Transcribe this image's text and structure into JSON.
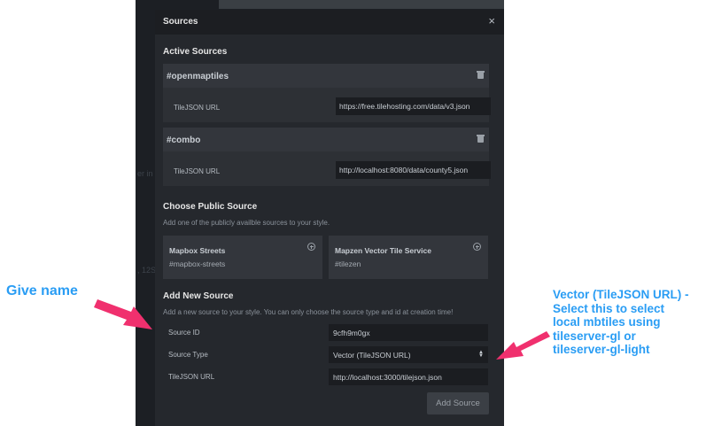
{
  "backdrop": {
    "ghost_text_1": "er in",
    "ghost_text_2": ", 12S"
  },
  "modal": {
    "title": "Sources",
    "close_icon": "×",
    "active": {
      "title": "Active Sources",
      "sources": [
        {
          "name": "#openmaptiles",
          "field_label": "TileJSON URL",
          "value": "https://free.tilehosting.com/data/v3.json"
        },
        {
          "name": "#combo",
          "field_label": "TileJSON URL",
          "value": "http://localhost:8080/data/county5.json"
        }
      ]
    },
    "public": {
      "title": "Choose Public Source",
      "description": "Add one of the publicly availble sources to your style.",
      "sources": [
        {
          "name": "Mapbox Streets",
          "id": "#mapbox-streets"
        },
        {
          "name": "Mapzen Vector Tile Service",
          "id": "#tilezen"
        }
      ]
    },
    "new_source": {
      "title": "Add New Source",
      "description": "Add a new source to your style. You can only choose the source type and id at creation time!",
      "source_id_label": "Source ID",
      "source_id_value": "9cfh9m0gx",
      "source_type_label": "Source Type",
      "source_type_value": "Vector (TileJSON URL)",
      "tilejson_label": "TileJSON URL",
      "tilejson_value": "http://localhost:3000/tilejson.json",
      "add_button": "Add Source"
    }
  },
  "annotations": {
    "left": "Give name",
    "right_lines": [
      "Vector (TileJSON URL) -",
      "Select this to select",
      "local mbtiles using",
      "tileserver-gl or",
      "tileserver-gl-light"
    ],
    "arrow_color": "#f0306e",
    "text_color": "#2a9df4"
  }
}
